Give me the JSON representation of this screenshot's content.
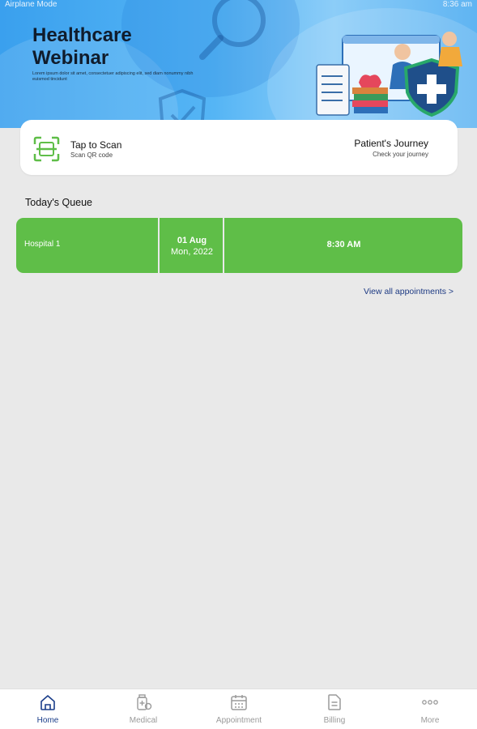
{
  "status_bar": {
    "left_text": "Airplane Mode",
    "right_text": "8:36 am"
  },
  "banner": {
    "title_line1": "Healthcare",
    "title_line2": "Webinar",
    "subtitle": "Lorem ipsum dolor sit amet, consectetuer adipiscing elit, sed diam nonummy nibh euismod tincidunt"
  },
  "actions": {
    "scan_title": "Tap to Scan",
    "scan_subtitle": "Scan QR code",
    "journey_title": "Patient's Journey",
    "journey_subtitle": "Check your journey"
  },
  "queue": {
    "section_title": "Today's Queue",
    "items": [
      {
        "hospital": "Hospital 1",
        "date_day": "01 Aug",
        "date_weekday_year": "Mon, 2022",
        "time": "8:30 AM"
      }
    ],
    "view_all_label": "View all appointments  >"
  },
  "nav": {
    "items": [
      {
        "label": "Home",
        "icon": "home-icon",
        "active": true
      },
      {
        "label": "Medical",
        "icon": "medical-icon",
        "active": false
      },
      {
        "label": "Appointment",
        "icon": "calendar-icon",
        "active": false
      },
      {
        "label": "Billing",
        "icon": "billing-icon",
        "active": false
      },
      {
        "label": "More",
        "icon": "more-icon",
        "active": false
      }
    ]
  },
  "colors": {
    "accent_green": "#5fbe48",
    "nav_active": "#1b3e8a",
    "link_blue": "#1d3a83",
    "banner_blue": "#3aa0ee",
    "page_bg": "#e9e9e9"
  }
}
